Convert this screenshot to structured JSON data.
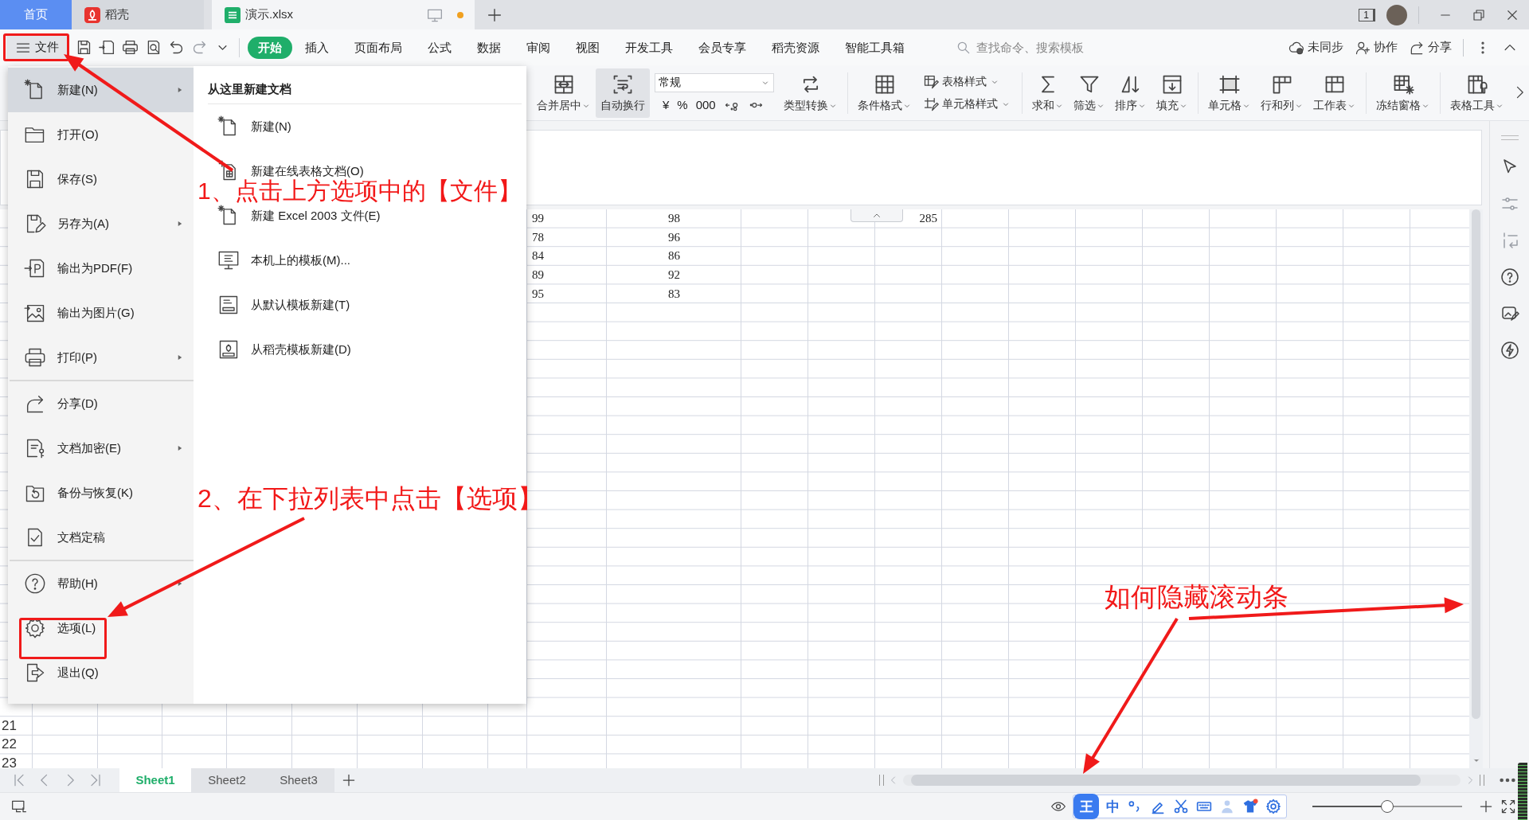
{
  "title_tabs": [
    {
      "label": "首页",
      "kind": "home",
      "selected": false
    },
    {
      "label": "稻壳",
      "kind": "docer",
      "selected": false
    },
    {
      "label": "演示.xlsx",
      "kind": "sheet",
      "selected": true,
      "modified": true
    }
  ],
  "window_count": "1",
  "file_button": "文件",
  "ribbon_tabs": [
    {
      "label": "开始",
      "selected": true
    },
    {
      "label": "插入",
      "selected": false
    },
    {
      "label": "页面布局",
      "selected": false
    },
    {
      "label": "公式",
      "selected": false
    },
    {
      "label": "数据",
      "selected": false
    },
    {
      "label": "审阅",
      "selected": false
    },
    {
      "label": "视图",
      "selected": false
    },
    {
      "label": "开发工具",
      "selected": false
    },
    {
      "label": "会员专享",
      "selected": false
    },
    {
      "label": "稻壳资源",
      "selected": false
    },
    {
      "label": "智能工具箱",
      "selected": false
    }
  ],
  "search": {
    "placeholder": "查找命令、搜索模板"
  },
  "top_actions": [
    {
      "label": "未同步",
      "kind": "cloud"
    },
    {
      "label": "协作",
      "kind": "user"
    },
    {
      "label": "分享",
      "kind": "share"
    }
  ],
  "ribbon_groups": [
    {
      "tools": [
        {
          "kind": "merge",
          "label": "合并居中",
          "dropdown": true,
          "on": false
        },
        {
          "kind": "wrap",
          "label": "自动换行",
          "dropdown": false,
          "on": true
        },
        {
          "kind": "number_format",
          "value": "常规",
          "symbols": [
            "¥",
            "%",
            "000"
          ]
        },
        {
          "kind": "convert",
          "label": "类型转换",
          "dropdown": true,
          "on": false
        }
      ]
    },
    {
      "tools": [
        {
          "kind": "conditional",
          "label": "条件格式",
          "dropdown": true,
          "on": false
        },
        {
          "kind": "styles",
          "items": [
            {
              "label": "表格样式"
            },
            {
              "label": "单元格样式"
            }
          ]
        }
      ]
    },
    {
      "tools": [
        {
          "kind": "sum",
          "label": "求和",
          "dropdown": true,
          "on": false
        },
        {
          "kind": "filter",
          "label": "筛选",
          "dropdown": true,
          "on": false
        },
        {
          "kind": "sort",
          "label": "排序",
          "dropdown": true,
          "on": false
        },
        {
          "kind": "fill",
          "label": "填充",
          "dropdown": true,
          "on": false
        }
      ]
    },
    {
      "tools": [
        {
          "kind": "cell",
          "label": "单元格",
          "dropdown": true,
          "on": false
        },
        {
          "kind": "rowcol",
          "label": "行和列",
          "dropdown": true,
          "on": false
        },
        {
          "kind": "sheet",
          "label": "工作表",
          "dropdown": true,
          "on": false
        }
      ]
    },
    {
      "tools": [
        {
          "kind": "freeze",
          "label": "冻结窗格",
          "dropdown": true,
          "on": false
        }
      ]
    },
    {
      "tools": [
        {
          "kind": "tools",
          "label": "表格工具",
          "dropdown": true,
          "on": false
        }
      ]
    }
  ],
  "file_menu": {
    "items": [
      {
        "label": "新建(N)",
        "kind": "new",
        "submenu": true,
        "selected": true,
        "divider_before": false
      },
      {
        "label": "打开(O)",
        "kind": "open",
        "submenu": false,
        "selected": false,
        "divider_before": false
      },
      {
        "label": "保存(S)",
        "kind": "save",
        "submenu": false,
        "selected": false,
        "divider_before": false
      },
      {
        "label": "另存为(A)",
        "kind": "save_as",
        "submenu": true,
        "selected": false,
        "divider_before": false
      },
      {
        "label": "输出为PDF(F)",
        "kind": "pdf",
        "submenu": false,
        "selected": false,
        "divider_before": false
      },
      {
        "label": "输出为图片(G)",
        "kind": "image",
        "submenu": false,
        "selected": false,
        "divider_before": false
      },
      {
        "label": "打印(P)",
        "kind": "print",
        "submenu": true,
        "selected": false,
        "divider_before": false
      },
      {
        "label": "分享(D)",
        "kind": "share",
        "submenu": false,
        "selected": false,
        "divider_before": true
      },
      {
        "label": "文档加密(E)",
        "kind": "encrypt",
        "submenu": true,
        "selected": false,
        "divider_before": false
      },
      {
        "label": "备份与恢复(K)",
        "kind": "backup",
        "submenu": false,
        "selected": false,
        "divider_before": false
      },
      {
        "label": "文档定稿",
        "kind": "finalize",
        "submenu": false,
        "selected": false,
        "divider_before": false
      },
      {
        "label": "帮助(H)",
        "kind": "help",
        "submenu": true,
        "selected": false,
        "divider_before": true
      },
      {
        "label": "选项(L)",
        "kind": "options",
        "submenu": false,
        "selected": false,
        "divider_before": false
      },
      {
        "label": "退出(Q)",
        "kind": "exit",
        "submenu": false,
        "selected": false,
        "divider_before": false
      }
    ],
    "panel": {
      "heading": "从这里新建文档",
      "items": [
        {
          "label": "新建(N)",
          "kind": "blank"
        },
        {
          "label": "新建在线表格文档(O)",
          "kind": "online"
        },
        {
          "label": "新建 Excel 2003 文件(E)",
          "kind": "blank"
        },
        {
          "label": "本机上的模板(M)...",
          "kind": "local"
        },
        {
          "label": "从默认模板新建(T)",
          "kind": "default"
        },
        {
          "label": "从稻壳模板新建(D)",
          "kind": "docer"
        }
      ]
    }
  },
  "sheet": {
    "rows": [
      {
        "values": [
          "99",
          "98"
        ],
        "total": "285"
      },
      {
        "values": [
          "78",
          "96"
        ]
      },
      {
        "values": [
          "84",
          "86"
        ]
      },
      {
        "values": [
          "89",
          "92"
        ]
      },
      {
        "values": [
          "95",
          "83"
        ]
      }
    ],
    "row_numbers": [
      "21",
      "22",
      "23"
    ]
  },
  "sheet_tabs": [
    {
      "label": "Sheet1",
      "selected": true
    },
    {
      "label": "Sheet2",
      "selected": false
    },
    {
      "label": "Sheet3",
      "selected": false
    }
  ],
  "status": {
    "ime_logo": "王",
    "ime_mode": "中",
    "zoom": {
      "level": 0.5
    }
  },
  "annotations": {
    "step_1": "1、点击上方选项中的【文件】",
    "step_2": "2、在下拉列表中点击【选项】",
    "note": "如何隐藏滚动条"
  }
}
